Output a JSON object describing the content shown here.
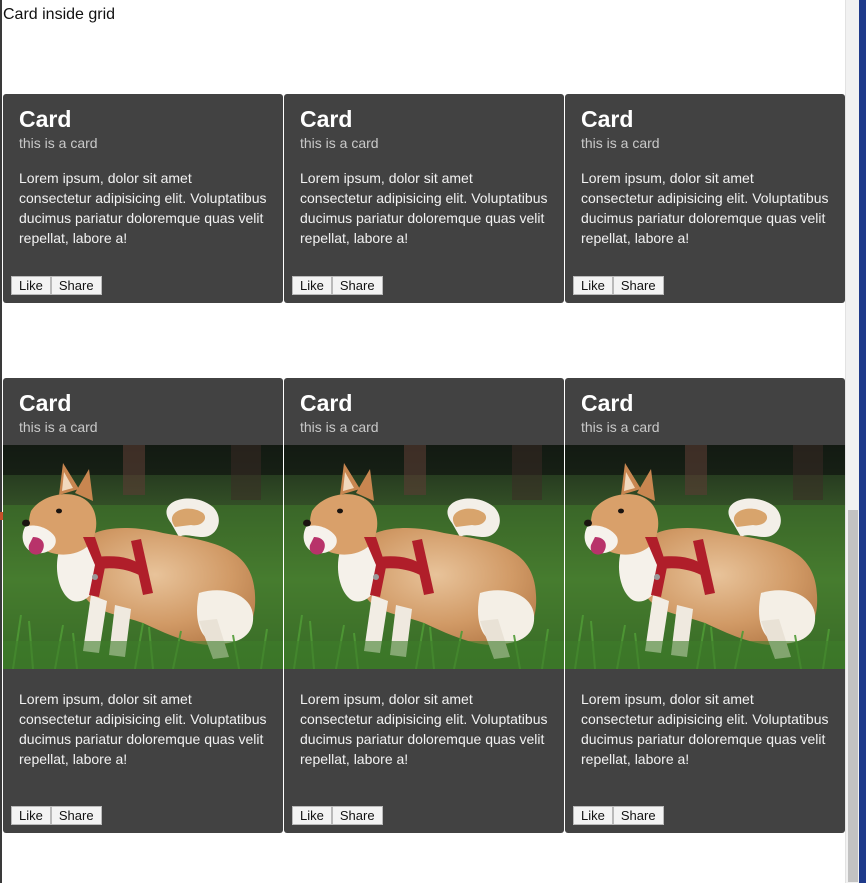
{
  "page": {
    "heading": "Card inside grid"
  },
  "grid_text_cards": [
    {
      "title": "Card",
      "subtitle": "this is a card",
      "body": "Lorem ipsum, dolor sit amet consectetur adipisicing elit. Voluptatibus ducimus pariatur doloremque quas velit repellat, labore a!",
      "like_label": "Like",
      "share_label": "Share"
    },
    {
      "title": "Card",
      "subtitle": "this is a card",
      "body": "Lorem ipsum, dolor sit amet consectetur adipisicing elit. Voluptatibus ducimus pariatur doloremque quas velit repellat, labore a!",
      "like_label": "Like",
      "share_label": "Share"
    },
    {
      "title": "Card",
      "subtitle": "this is a card",
      "body": "Lorem ipsum, dolor sit amet consectetur adipisicing elit. Voluptatibus ducimus pariatur doloremque quas velit repellat, labore a!",
      "like_label": "Like",
      "share_label": "Share"
    }
  ],
  "grid_media_cards": [
    {
      "title": "Card",
      "subtitle": "this is a card",
      "image": "shiba-inu-dog-on-grass-photo",
      "body": "Lorem ipsum, dolor sit amet consectetur adipisicing elit. Voluptatibus ducimus pariatur doloremque quas velit repellat, labore a!",
      "like_label": "Like",
      "share_label": "Share"
    },
    {
      "title": "Card",
      "subtitle": "this is a card",
      "image": "shiba-inu-dog-on-grass-photo",
      "body": "Lorem ipsum, dolor sit amet consectetur adipisicing elit. Voluptatibus ducimus pariatur doloremque quas velit repellat, labore a!",
      "like_label": "Like",
      "share_label": "Share"
    },
    {
      "title": "Card",
      "subtitle": "this is a card",
      "image": "shiba-inu-dog-on-grass-photo",
      "body": "Lorem ipsum, dolor sit amet consectetur adipisicing elit. Voluptatibus ducimus pariatur doloremque quas velit repellat, labore a!",
      "like_label": "Like",
      "share_label": "Share"
    }
  ],
  "colors": {
    "card_background": "#424242",
    "subtitle_text": "#c9c9c9",
    "page_background": "#ffffff",
    "window_border": "#1e3a8a"
  }
}
